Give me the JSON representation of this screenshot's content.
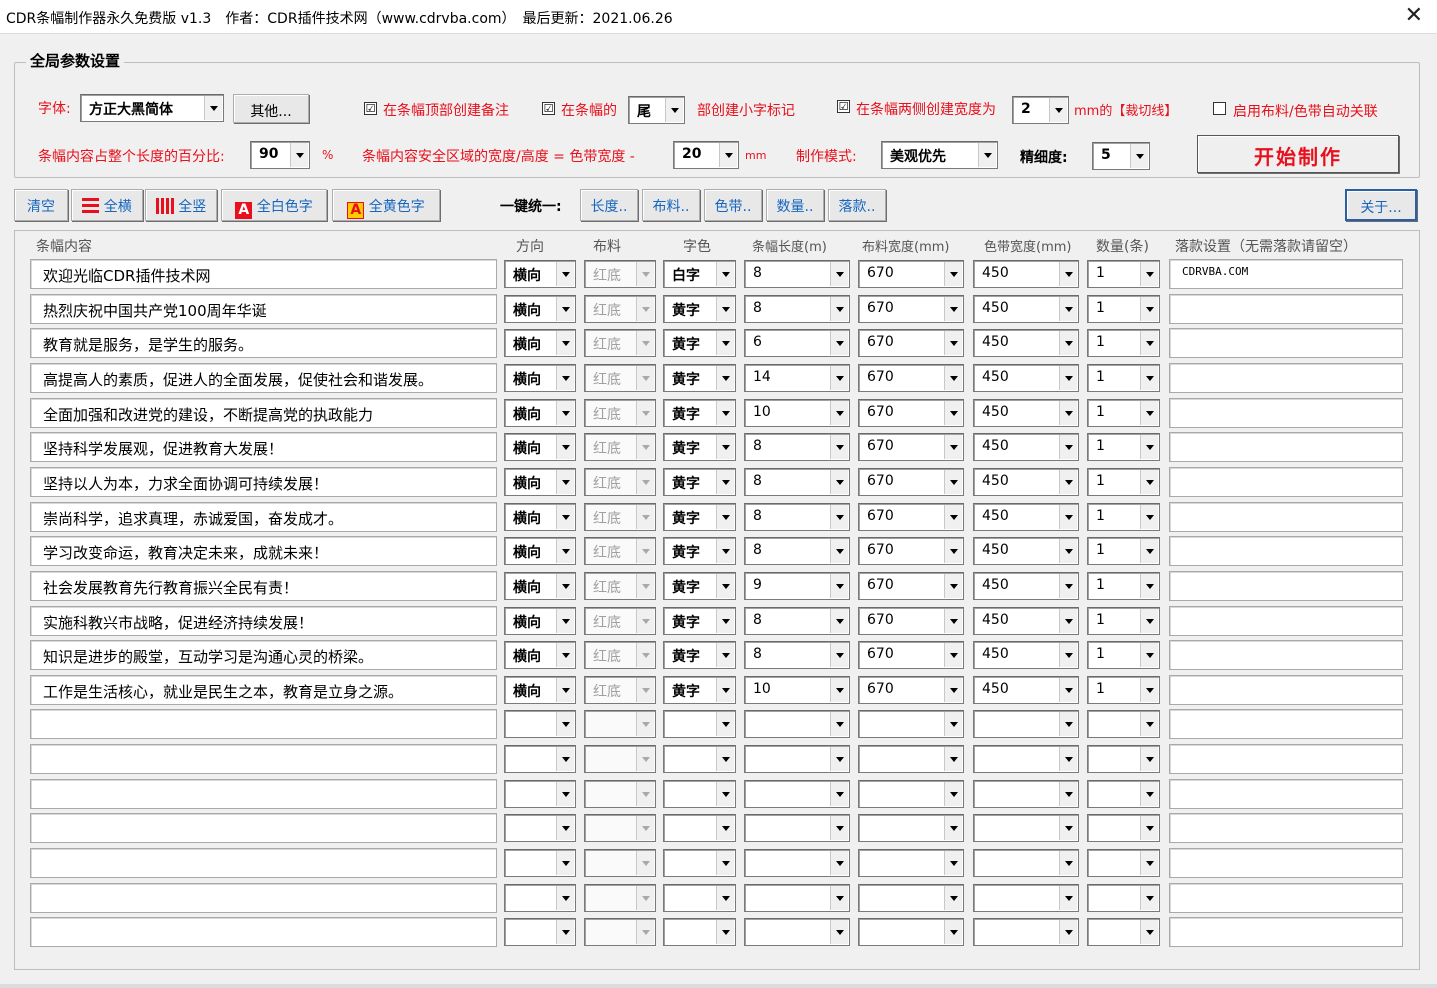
{
  "window": {
    "title": "CDR条幅制作器永久免费版 v1.3　作者：CDR插件技术网（www.cdrvba.com）　最后更新：2021.06.26",
    "close_icon": "✕"
  },
  "global": {
    "legend": "全局参数设置",
    "font_label": "字体:",
    "font_value": "方正大黑简体",
    "other_button": "其他...",
    "top_note_check": "☑",
    "top_note_label": "在条幅顶部创建备注",
    "small_mark_check": "☑",
    "small_mark_label1": "在条幅的",
    "small_mark_pos": "尾",
    "small_mark_label2": "部创建小字标记",
    "cut_line_check": "☑",
    "cut_line_label1": "在条幅两侧创建宽度为",
    "cut_line_value": "2",
    "cut_line_label2": "mm的【裁切线】",
    "auto_link_check": "",
    "auto_link_label": "启用布料/色带自动关联",
    "percent_label": "条幅内容占整个长度的百分比:",
    "percent_value": "90",
    "percent_unit": "%",
    "safe_label": "条幅内容安全区域的宽度/高度 = 色带宽度 -",
    "safe_value": "20",
    "safe_unit": "mm",
    "mode_label": "制作模式:",
    "mode_value": "美观优先",
    "precision_label": "精细度:",
    "precision_value": "5",
    "start_button": "开始制作"
  },
  "toolbar": {
    "clear": "清空",
    "all_horizontal": "全横",
    "all_vertical": "全竖",
    "all_white": "全白色字",
    "all_yellow": "全黄色字",
    "icon_letter": "A",
    "unify_label": "一键统一:",
    "length": "长度..",
    "fabric": "布料..",
    "band": "色带..",
    "quantity": "数量..",
    "signature": "落款..",
    "about": "关于..."
  },
  "table": {
    "headers": [
      "条幅内容",
      "方向",
      "布料",
      "字色",
      "条幅长度(m)",
      "布料宽度(mm)",
      "色带宽度(mm)",
      "数量(条)",
      "落款设置（无需落款请留空）"
    ],
    "rows": [
      {
        "content": "欢迎光临CDR插件技术网",
        "dir": "横向",
        "fabric": "红底",
        "color": "白字",
        "length": "8",
        "fwidth": "670",
        "bwidth": "450",
        "qty": "1",
        "sig": "CDRVBA.COM"
      },
      {
        "content": "热烈庆祝中国共产党100周年华诞",
        "dir": "横向",
        "fabric": "红底",
        "color": "黄字",
        "length": "8",
        "fwidth": "670",
        "bwidth": "450",
        "qty": "1",
        "sig": ""
      },
      {
        "content": "教育就是服务，是学生的服务。",
        "dir": "横向",
        "fabric": "红底",
        "color": "黄字",
        "length": "6",
        "fwidth": "670",
        "bwidth": "450",
        "qty": "1",
        "sig": ""
      },
      {
        "content": "高提高人的素质，促进人的全面发展，促使社会和谐发展。",
        "dir": "横向",
        "fabric": "红底",
        "color": "黄字",
        "length": "14",
        "fwidth": "670",
        "bwidth": "450",
        "qty": "1",
        "sig": ""
      },
      {
        "content": "全面加强和改进党的建设，不断提高党的执政能力",
        "dir": "横向",
        "fabric": "红底",
        "color": "黄字",
        "length": "10",
        "fwidth": "670",
        "bwidth": "450",
        "qty": "1",
        "sig": ""
      },
      {
        "content": "坚持科学发展观，促进教育大发展！",
        "dir": "横向",
        "fabric": "红底",
        "color": "黄字",
        "length": "8",
        "fwidth": "670",
        "bwidth": "450",
        "qty": "1",
        "sig": ""
      },
      {
        "content": "坚持以人为本，力求全面协调可持续发展！",
        "dir": "横向",
        "fabric": "红底",
        "color": "黄字",
        "length": "8",
        "fwidth": "670",
        "bwidth": "450",
        "qty": "1",
        "sig": ""
      },
      {
        "content": "崇尚科学，追求真理，赤诚爱国，奋发成才。",
        "dir": "横向",
        "fabric": "红底",
        "color": "黄字",
        "length": "8",
        "fwidth": "670",
        "bwidth": "450",
        "qty": "1",
        "sig": ""
      },
      {
        "content": "学习改变命运，教育决定未来，成就未来！",
        "dir": "横向",
        "fabric": "红底",
        "color": "黄字",
        "length": "8",
        "fwidth": "670",
        "bwidth": "450",
        "qty": "1",
        "sig": ""
      },
      {
        "content": "社会发展教育先行教育振兴全民有责！",
        "dir": "横向",
        "fabric": "红底",
        "color": "黄字",
        "length": "9",
        "fwidth": "670",
        "bwidth": "450",
        "qty": "1",
        "sig": ""
      },
      {
        "content": "实施科教兴市战略，促进经济持续发展！",
        "dir": "横向",
        "fabric": "红底",
        "color": "黄字",
        "length": "8",
        "fwidth": "670",
        "bwidth": "450",
        "qty": "1",
        "sig": ""
      },
      {
        "content": "知识是进步的殿堂，互动学习是沟通心灵的桥梁。",
        "dir": "横向",
        "fabric": "红底",
        "color": "黄字",
        "length": "8",
        "fwidth": "670",
        "bwidth": "450",
        "qty": "1",
        "sig": ""
      },
      {
        "content": "工作是生活核心，就业是民生之本，教育是立身之源。",
        "dir": "横向",
        "fabric": "红底",
        "color": "黄字",
        "length": "10",
        "fwidth": "670",
        "bwidth": "450",
        "qty": "1",
        "sig": ""
      },
      {
        "content": "",
        "dir": "",
        "fabric": "",
        "color": "",
        "length": "",
        "fwidth": "",
        "bwidth": "",
        "qty": "",
        "sig": ""
      },
      {
        "content": "",
        "dir": "",
        "fabric": "",
        "color": "",
        "length": "",
        "fwidth": "",
        "bwidth": "",
        "qty": "",
        "sig": ""
      },
      {
        "content": "",
        "dir": "",
        "fabric": "",
        "color": "",
        "length": "",
        "fwidth": "",
        "bwidth": "",
        "qty": "",
        "sig": ""
      },
      {
        "content": "",
        "dir": "",
        "fabric": "",
        "color": "",
        "length": "",
        "fwidth": "",
        "bwidth": "",
        "qty": "",
        "sig": ""
      },
      {
        "content": "",
        "dir": "",
        "fabric": "",
        "color": "",
        "length": "",
        "fwidth": "",
        "bwidth": "",
        "qty": "",
        "sig": ""
      },
      {
        "content": "",
        "dir": "",
        "fabric": "",
        "color": "",
        "length": "",
        "fwidth": "",
        "bwidth": "",
        "qty": "",
        "sig": ""
      },
      {
        "content": "",
        "dir": "",
        "fabric": "",
        "color": "",
        "length": "",
        "fwidth": "",
        "bwidth": "",
        "qty": "",
        "sig": ""
      }
    ]
  },
  "colors": {
    "accent_red": "#e8101c",
    "link_blue": "#1666c0",
    "background": "#f0f0f0"
  }
}
